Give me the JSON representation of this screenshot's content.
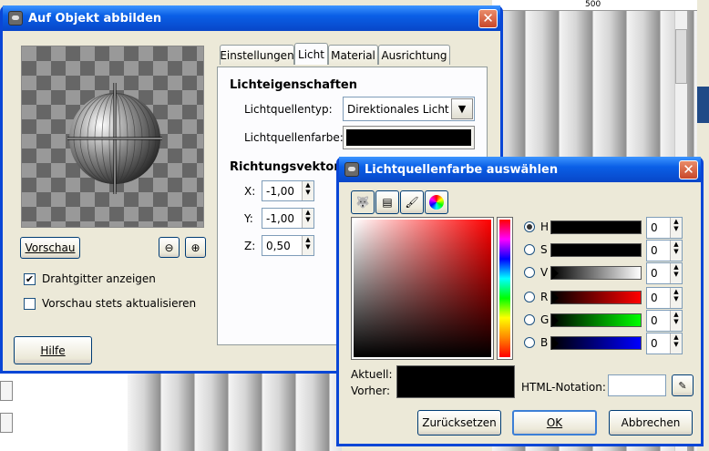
{
  "background": {
    "ruler_marks": [
      "500"
    ]
  },
  "map_dialog": {
    "title": "Auf Objekt abbilden",
    "close_label": "✕",
    "preview_button": "Vorschau",
    "wireframe_label": "Drahtgitter anzeigen",
    "wireframe_checked": true,
    "auto_update_label": "Vorschau stets aktualisieren",
    "auto_update_checked": false,
    "help_button": "Hilfe",
    "tabs": [
      "Einstellungen",
      "Licht",
      "Material",
      "Ausrichtung"
    ],
    "active_tab": "Licht",
    "light_props_heading": "Lichteigenschaften",
    "light_type_label": "Lichtquellentyp:",
    "light_type_value": "Direktionales Licht",
    "light_color_label": "Lichtquellenfarbe:",
    "direction_heading": "Richtungsvektor",
    "x_label": "X:",
    "x_value": "-1,00",
    "y_label": "Y:",
    "y_value": "-1,00",
    "z_label": "Z:",
    "z_value": "0,50",
    "zoom_out_icon": "zoom-out-icon",
    "zoom_in_icon": "zoom-in-icon"
  },
  "color_dialog": {
    "title": "Lichtquellenfarbe auswählen",
    "close_label": "✕",
    "channels": [
      {
        "key": "H",
        "value": "0",
        "selected": true
      },
      {
        "key": "S",
        "value": "0",
        "selected": false
      },
      {
        "key": "V",
        "value": "0",
        "selected": false
      },
      {
        "key": "R",
        "value": "0",
        "selected": false
      },
      {
        "key": "G",
        "value": "0",
        "selected": false
      },
      {
        "key": "B",
        "value": "0",
        "selected": false
      }
    ],
    "current_label": "Aktuell:",
    "previous_label": "Vorher:",
    "html_notation_label": "HTML-Notation:",
    "html_notation_value": "",
    "reset_button": "Zurücksetzen",
    "ok_button": "OK",
    "cancel_button": "Abbrechen",
    "current_color": "#000000",
    "accent_color": "#0a46d6"
  }
}
